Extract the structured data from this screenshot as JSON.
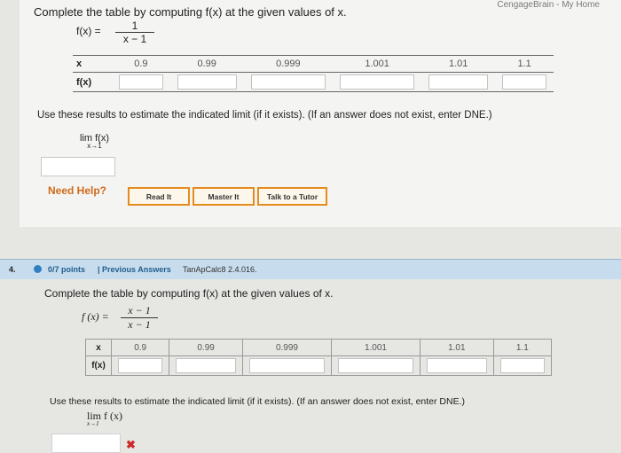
{
  "header": {
    "top_right": "CengageBrain - My Home"
  },
  "q3": {
    "title": "Complete the table by computing f(x) at the given values of x.",
    "eq_lhs": "f(x) =",
    "eq_num": "1",
    "eq_den": "x − 1",
    "row_x_label": "x",
    "row_fx_label": "f(x)",
    "x_values": [
      "0.9",
      "0.99",
      "0.999",
      "1.001",
      "1.01",
      "1.1"
    ],
    "instruction": "Use these results to estimate the indicated limit (if it exists). (If an answer does not exist, enter DNE.)",
    "limit_top": "lim f(x)",
    "limit_sub": "x→1",
    "help_label": "Need Help?",
    "buttons": {
      "read": "Read It",
      "master": "Master It",
      "tutor": "Talk to a Tutor"
    }
  },
  "q4": {
    "number": "4.",
    "points": "0/7 points",
    "previous": "| Previous Answers",
    "code": "TanApCalc8 2.4.016.",
    "title": "Complete the table by computing f(x) at the given values of x.",
    "eq_lhs": "f (x) =",
    "eq_num": "x − 1",
    "eq_den": "x − 1",
    "row_x_label": "x",
    "row_fx_label": "f(x)",
    "x_values": [
      "0.9",
      "0.99",
      "0.999",
      "1.001",
      "1.01",
      "1.1"
    ],
    "instruction": "Use these results to estimate the indicated limit (if it exists). (If an answer does not exist, enter DNE.)",
    "limit_top": "lim f (x)",
    "limit_sub": "x→1",
    "mark": "✖"
  }
}
